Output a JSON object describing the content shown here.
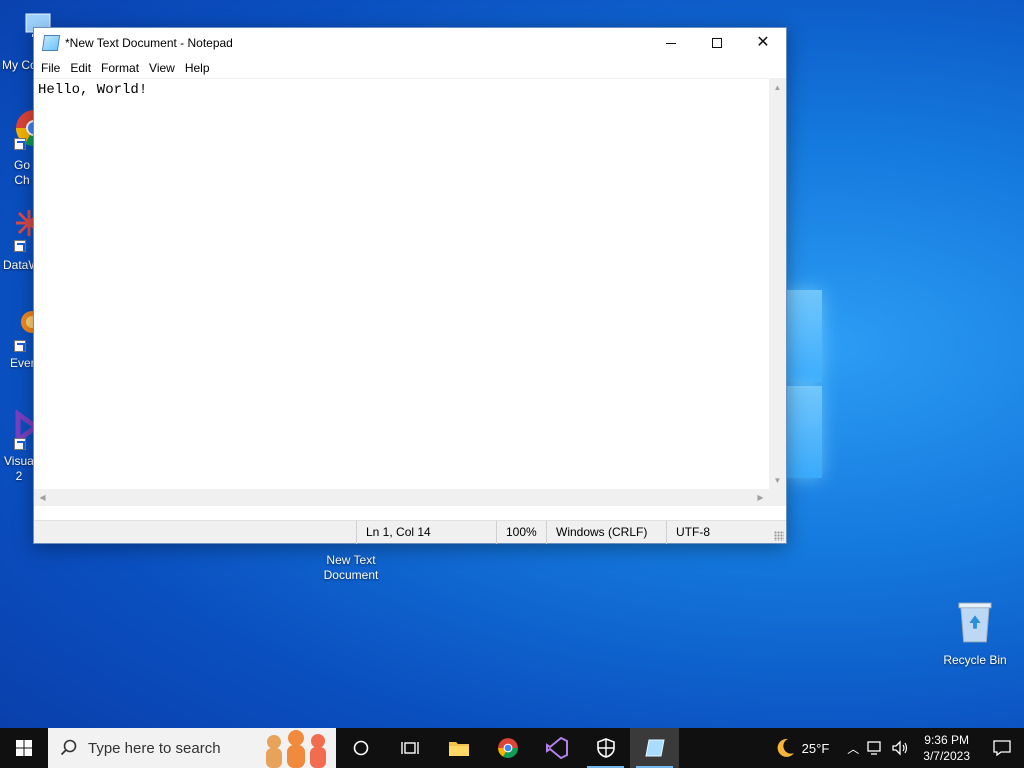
{
  "desktop": {
    "icons": [
      {
        "label": "My Co"
      },
      {
        "label": "Go\nCh"
      },
      {
        "label": "DataW"
      },
      {
        "label": "Ever"
      },
      {
        "label": "Visua\n2"
      }
    ],
    "file_icon_label": "New Text\nDocument",
    "recycle_bin_label": "Recycle Bin"
  },
  "window": {
    "title": "*New Text Document - Notepad",
    "menu": [
      "File",
      "Edit",
      "Format",
      "View",
      "Help"
    ],
    "content": "Hello, World!",
    "status": {
      "position": "Ln 1, Col 14",
      "zoom": "100%",
      "line_ending": "Windows (CRLF)",
      "encoding": "UTF-8"
    }
  },
  "taskbar": {
    "search_placeholder": "Type here to search",
    "weather_temp": "25°F",
    "time": "9:36 PM",
    "date": "3/7/2023"
  },
  "colors": {
    "desktop_blue": "#1478dc",
    "taskbar": "#101010",
    "accent": "#76b9ed"
  }
}
